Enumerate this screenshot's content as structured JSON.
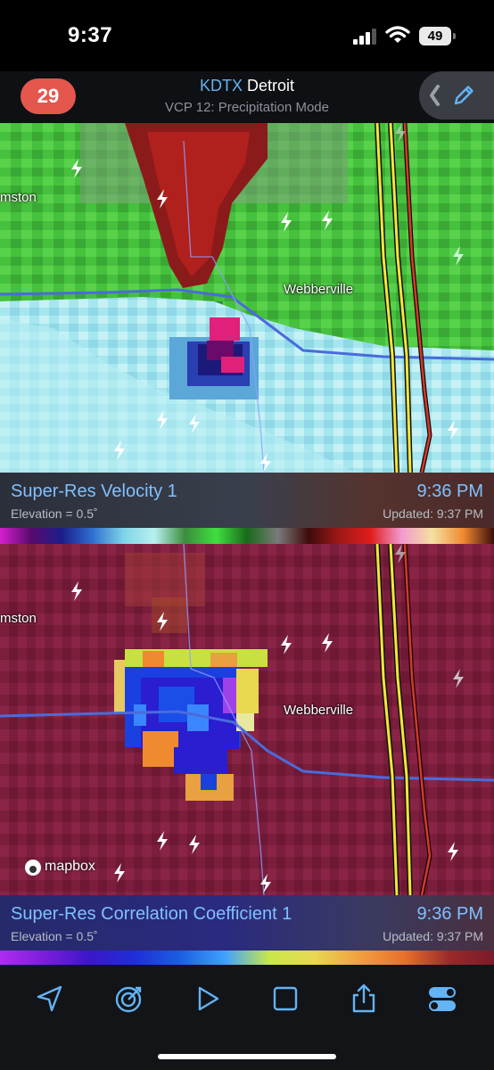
{
  "status_bar": {
    "time": "9:37",
    "battery": "49"
  },
  "header": {
    "alert_count": "29",
    "station_code": "KDTX",
    "station_city": "Detroit",
    "vcp_mode": "VCP 12: Precipitation Mode"
  },
  "map_labels": {
    "town_west": "mston",
    "town_east": "Webberville",
    "attribution": "mapbox"
  },
  "panels": [
    {
      "product": "Super-Res Velocity 1",
      "elevation": "Elevation = 0.5˚",
      "scan_time": "9:36 PM",
      "updated": "Updated: 9:37 PM",
      "scale_colors": [
        "#d41fd1",
        "#5a0a6e",
        "#1b1e8a",
        "#2f6fd0",
        "#7fd4e8",
        "#b8f0f0",
        "#3b8c3b",
        "#3fe03f",
        "#1a6a1a",
        "#7a7a7a",
        "#3d0b0b",
        "#a01818",
        "#e01c1c",
        "#f29ad0",
        "#f5e0a0",
        "#f08a30",
        "#3b0d0d"
      ]
    },
    {
      "product": "Super-Res Correlation Coefficient 1",
      "elevation": "Elevation = 0.5˚",
      "scan_time": "9:36 PM",
      "updated": "Updated: 9:37 PM",
      "scale_colors": [
        "#b02cf0",
        "#7b1ddb",
        "#3a17c8",
        "#1f2fd8",
        "#1a5ee0",
        "#3fa0ff",
        "#c8e84a",
        "#e8d850",
        "#f0a040",
        "#e8702a",
        "#9a2a2a",
        "#7a1a2a"
      ]
    }
  ],
  "tabs": [
    "location-arrow-icon",
    "radar-target-icon",
    "play-icon",
    "square-icon",
    "share-icon",
    "toggles-icon"
  ],
  "colors": {
    "accent": "#62b4f5",
    "badge": "#e5564c",
    "velocity_green": "#45c43c",
    "velocity_teal": "#9fe3ee",
    "cc_background": "#7a1e3c"
  }
}
